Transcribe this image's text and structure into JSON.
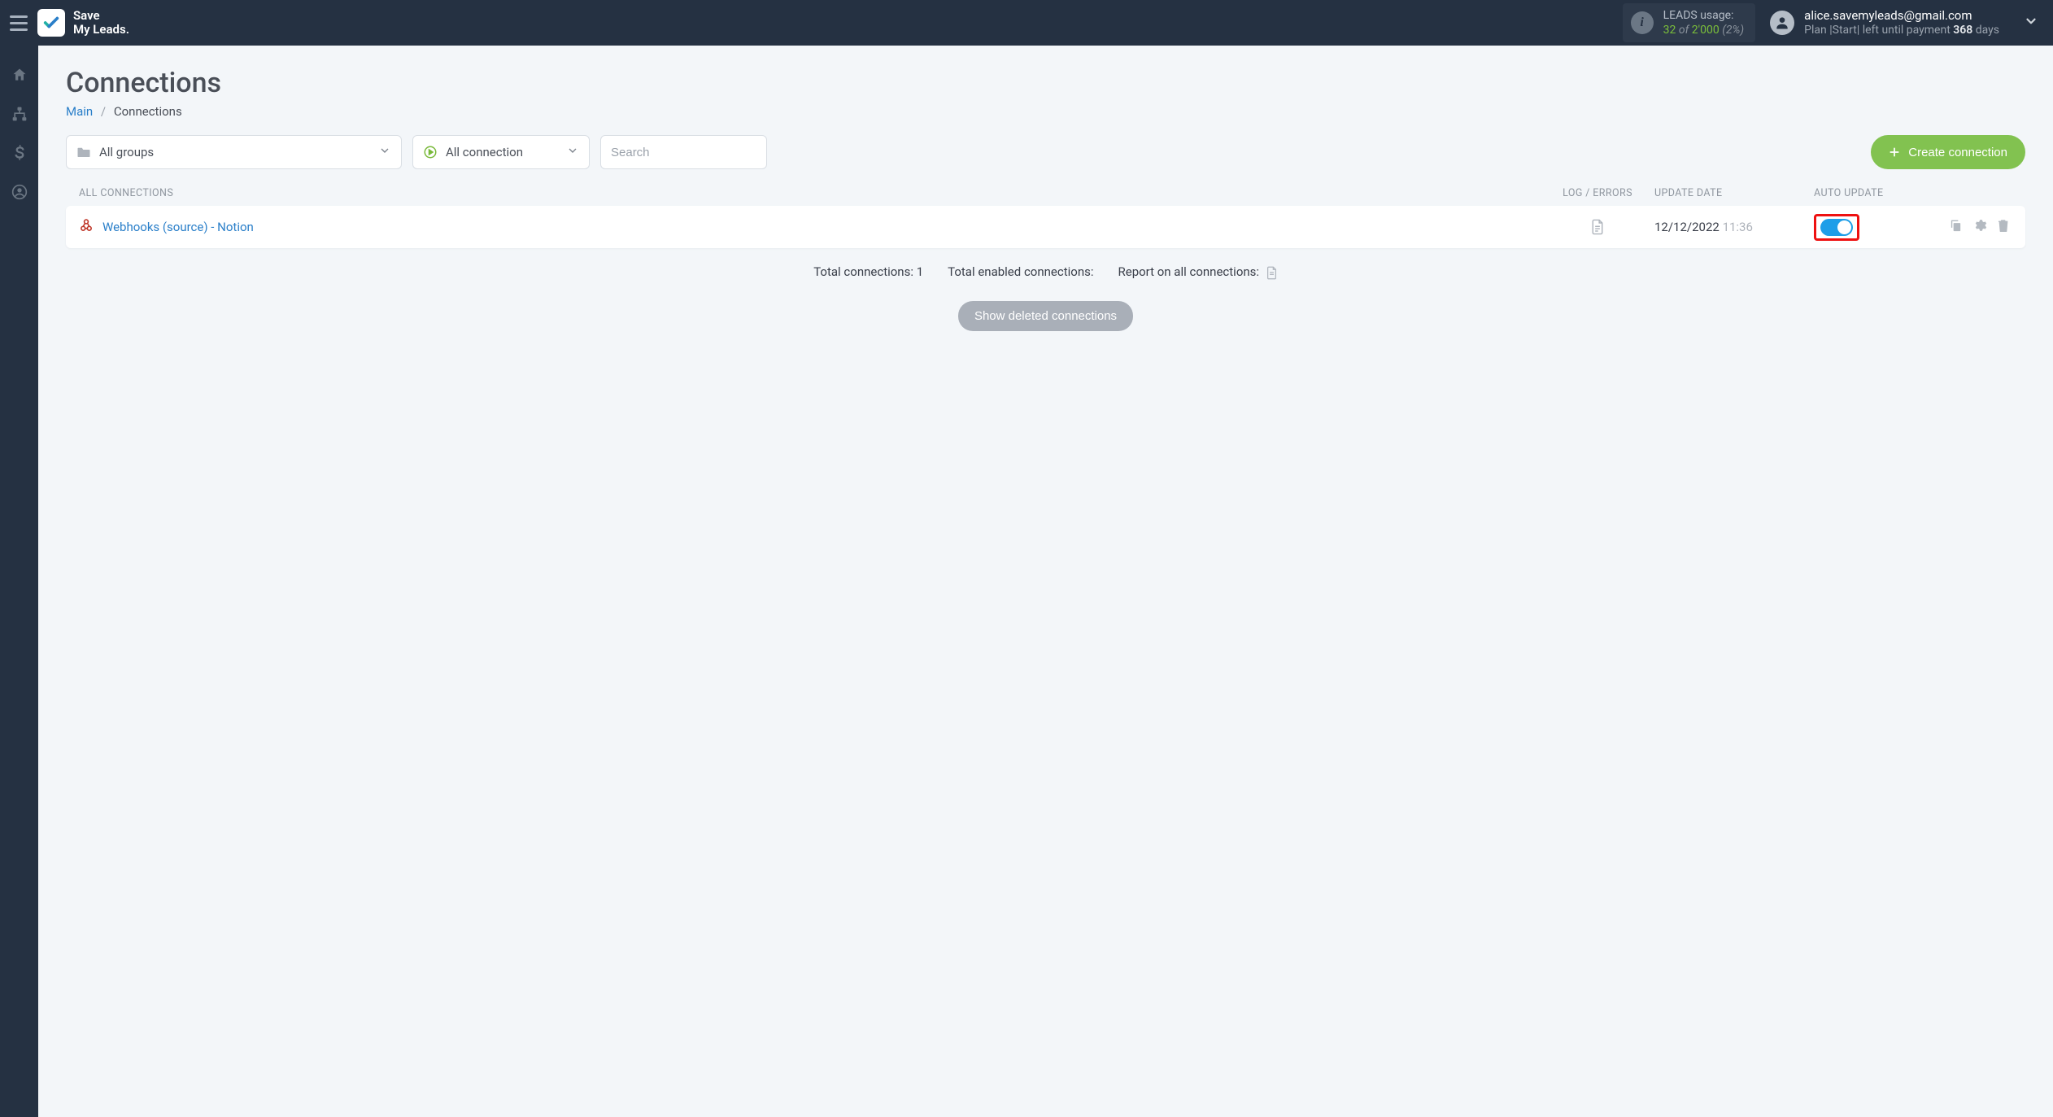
{
  "brand": {
    "line1": "Save",
    "line2": "My Leads."
  },
  "usage": {
    "label": "LEADS usage:",
    "used": "32",
    "of": "of",
    "total": "2'000",
    "percent": "(2%)"
  },
  "account": {
    "email": "alice.savemyleads@gmail.com",
    "plan_prefix": "Plan |",
    "plan_name": "Start",
    "plan_mid": "| left until payment ",
    "days_num": "368",
    "days_word": " days"
  },
  "page": {
    "title": "Connections",
    "breadcrumb_main": "Main",
    "breadcrumb_current": "Connections"
  },
  "filters": {
    "groups_label": "All groups",
    "connection_label": "All connection",
    "search_placeholder": "Search"
  },
  "create_button": "Create connection",
  "columns": {
    "all": "ALL CONNECTIONS",
    "log": "LOG / ERRORS",
    "date": "UPDATE DATE",
    "auto": "AUTO UPDATE"
  },
  "rows": [
    {
      "name": "Webhooks (source) - Notion",
      "date": "12/12/2022",
      "time": "11:36",
      "auto_update": true
    }
  ],
  "summary": {
    "total_label": "Total connections: ",
    "total_value": "1",
    "enabled_label": "Total enabled connections:",
    "report_label": "Report on all connections:"
  },
  "show_deleted": "Show deleted connections"
}
